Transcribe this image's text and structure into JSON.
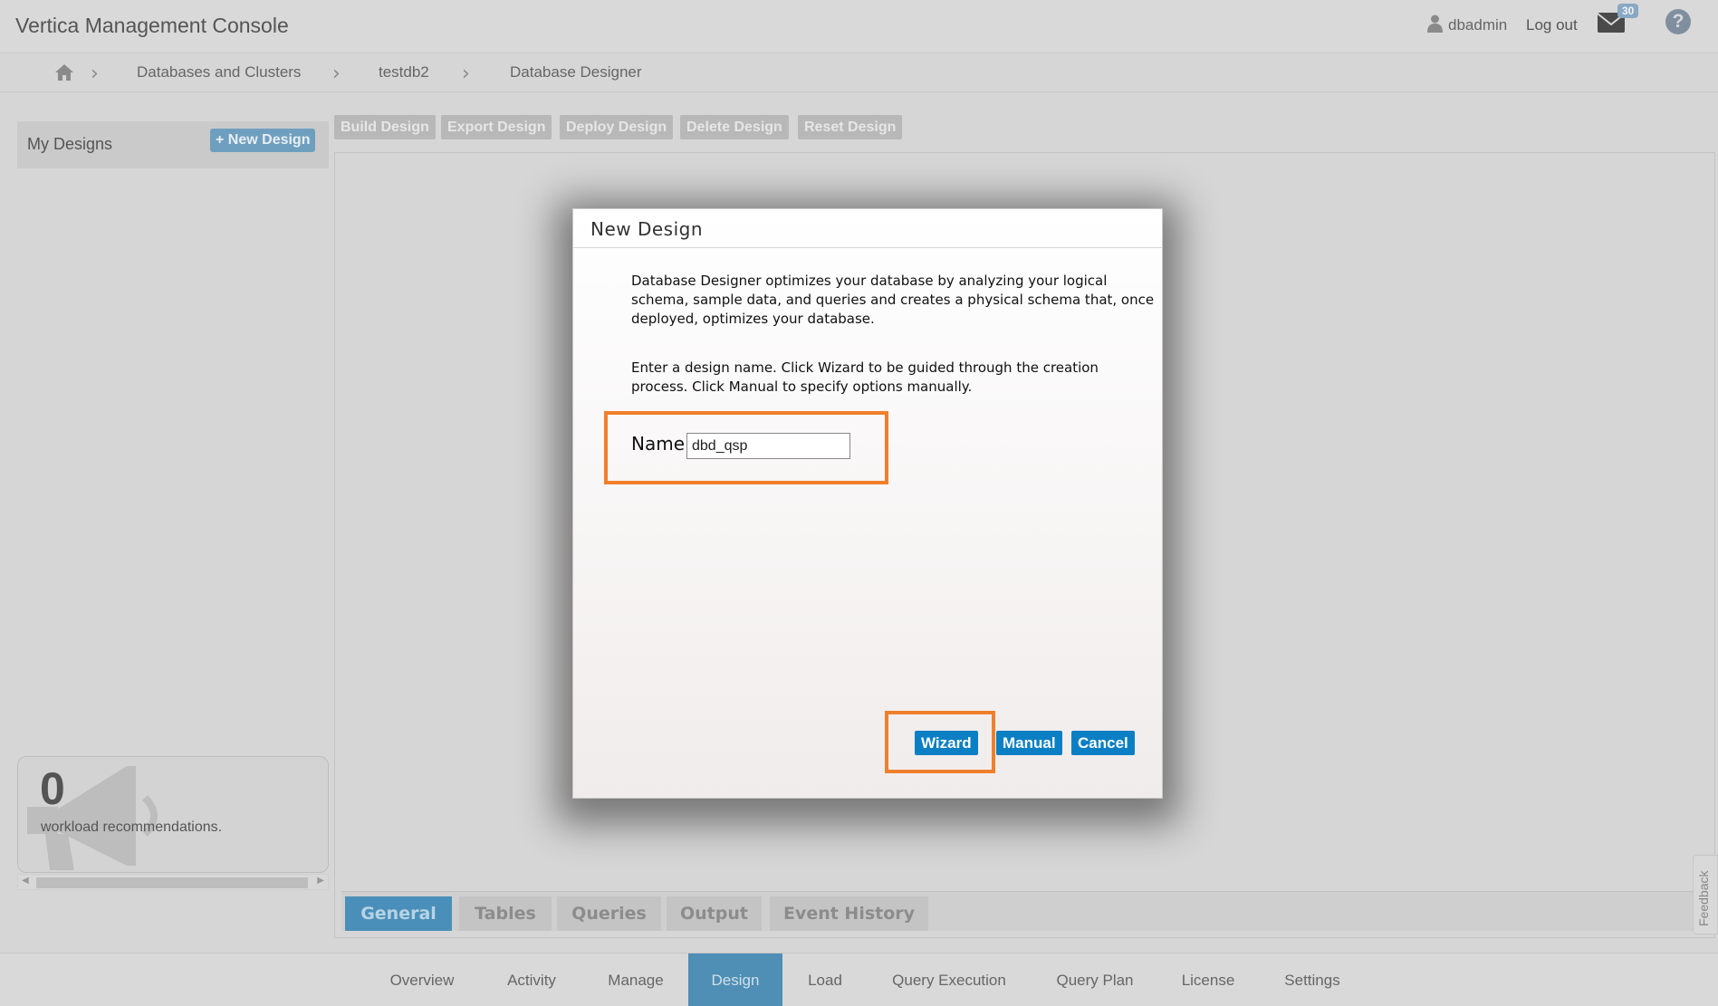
{
  "header": {
    "app_title": "Vertica Management Console",
    "user_name": "dbadmin",
    "logout_label": "Log out",
    "mail_count": "30",
    "help_label": "?"
  },
  "breadcrumb": {
    "items": [
      "Databases and Clusters",
      "testdb2",
      "Database Designer"
    ],
    "separator": "›"
  },
  "sidebar": {
    "title": "My Designs",
    "new_design_label": "+ New Design",
    "recommendation_count": "0",
    "recommendation_label": "workload recommendations."
  },
  "toolbar": {
    "buttons": [
      "Build Design",
      "Export Design",
      "Deploy Design",
      "Delete Design",
      "Reset Design"
    ]
  },
  "inner_tabs": {
    "items": [
      "General",
      "Tables",
      "Queries",
      "Output",
      "Event History"
    ],
    "active": "General"
  },
  "feedback_label": "Feedback",
  "bottom_nav": {
    "items": [
      "Overview",
      "Activity",
      "Manage",
      "Design",
      "Load",
      "Query Execution",
      "Query Plan",
      "License",
      "Settings"
    ],
    "active": "Design"
  },
  "modal": {
    "title": "New Design",
    "description": "Database Designer optimizes your database by analyzing your logical schema, sample data, and queries and creates a physical schema that, once deployed, optimizes your database.",
    "instructions": "Enter a design name. Click Wizard to be guided through the creation process. Click Manual to specify options manually.",
    "name_label": "Name:",
    "name_value": "dbd_qsp",
    "wizard_label": "Wizard",
    "manual_label": "Manual",
    "cancel_label": "Cancel"
  },
  "colors": {
    "accent": "#0a7fc4",
    "highlight": "#f07f2c",
    "active_tab": "#4a8fb9"
  }
}
